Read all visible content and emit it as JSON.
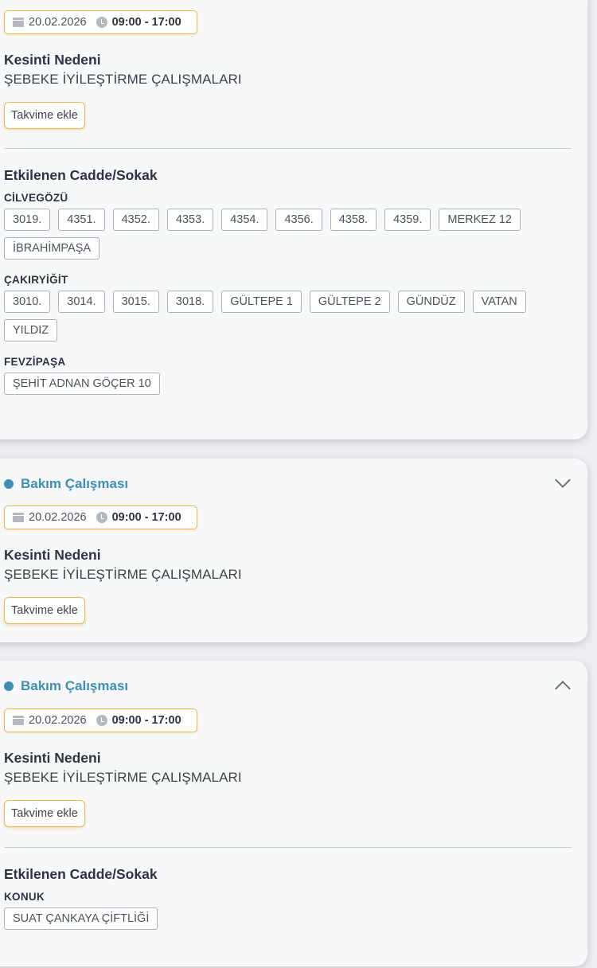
{
  "cards": [
    {
      "type_label": "",
      "date": "20.02.2026",
      "time": "09:00 - 17:00",
      "reason_title": "Kesinti Nedeni",
      "reason_text": "ŞEBEKE İYİLEŞTİRME ÇALIŞMALARI",
      "calendar_button": "Takvime ekle",
      "affected_title": "Etkilenen Cadde/Sokak",
      "districts": [
        {
          "name": "CİLVEGÖZÜ",
          "streets": [
            "3019.",
            "4351.",
            "4352.",
            "4353.",
            "4354.",
            "4356.",
            "4358.",
            "4359.",
            "MERKEZ 12",
            "İBRAHİMPAŞA"
          ]
        },
        {
          "name": "ÇAKIRYİĞİT",
          "streets": [
            "3010.",
            "3014.",
            "3015.",
            "3018.",
            "GÜLTEPE 1",
            "GÜLTEPE 2",
            "GÜNDÜZ",
            "VATAN",
            "YILDIZ"
          ]
        },
        {
          "name": "FEVZİPAŞA",
          "streets": [
            "ŞEHİT ADNAN GÖÇER 10"
          ]
        }
      ]
    },
    {
      "type_label": "Bakım Çalışması",
      "expanded": false,
      "date": "20.02.2026",
      "time": "09:00 - 17:00",
      "reason_title": "Kesinti Nedeni",
      "reason_text": "ŞEBEKE İYİLEŞTİRME ÇALIŞMALARI",
      "calendar_button": "Takvime ekle"
    },
    {
      "type_label": "Bakım Çalışması",
      "expanded": true,
      "date": "20.02.2026",
      "time": "09:00 - 17:00",
      "reason_title": "Kesinti Nedeni",
      "reason_text": "ŞEBEKE İYİLEŞTİRME ÇALIŞMALARI",
      "calendar_button": "Takvime ekle",
      "affected_title": "Etkilenen Cadde/Sokak",
      "districts": [
        {
          "name": "KONUK",
          "streets": [
            "SUAT ÇANKAYA ÇİFTLİĞİ"
          ]
        }
      ]
    }
  ],
  "colors": {
    "accent": "#3f8fb4",
    "highlight_border": "#f2b54d",
    "chip_border": "#a9b1bc"
  },
  "icons": {
    "date": "calendar-icon",
    "time": "clock-icon",
    "collapsed": "chevron-down-icon",
    "expanded": "chevron-up-icon",
    "type": "status-dot-icon"
  }
}
